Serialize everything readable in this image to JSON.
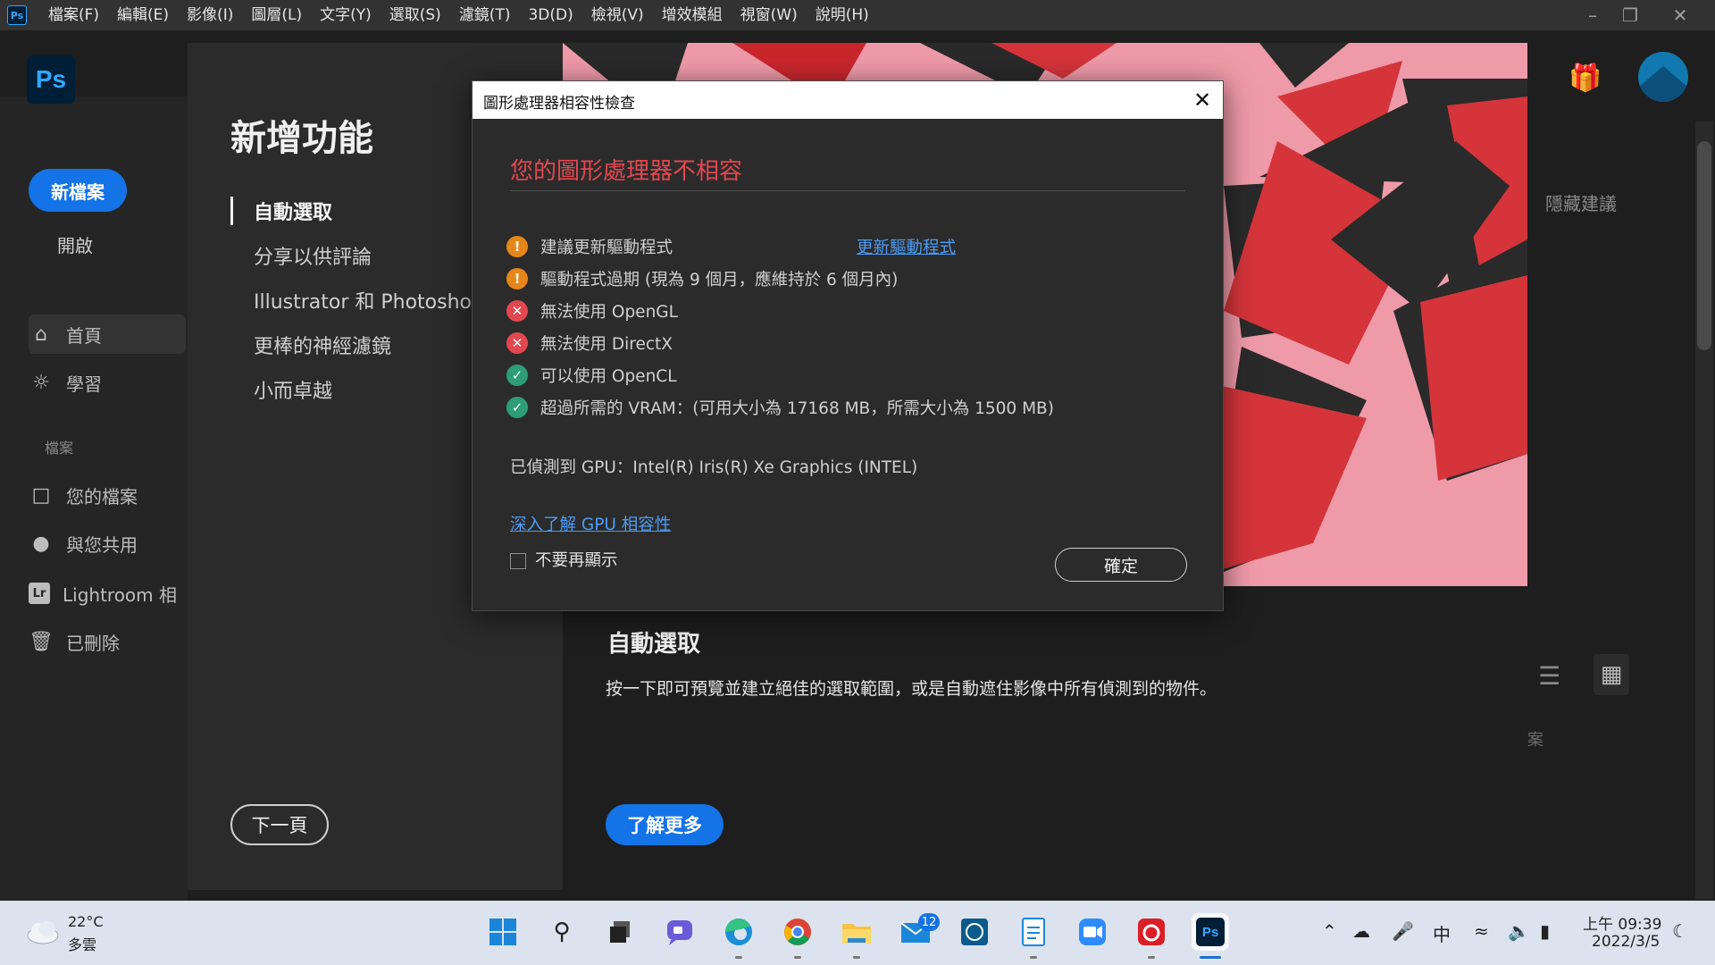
{
  "menubar": {
    "app_icon": "Ps",
    "items": [
      "檔案(F)",
      "編輯(E)",
      "影像(I)",
      "圖層(L)",
      "文字(Y)",
      "選取(S)",
      "濾鏡(T)",
      "3D(D)",
      "檢視(V)",
      "增效模組",
      "視窗(W)",
      "說明(H)"
    ]
  },
  "home": {
    "logo": "Ps",
    "new_file": "新檔案",
    "open": "開啟",
    "nav": [
      {
        "label": "首頁",
        "icon": "home-icon"
      },
      {
        "label": "學習",
        "icon": "lightbulb-icon"
      }
    ],
    "files_section": "檔案",
    "files_nav": [
      {
        "label": "您的檔案",
        "icon": "document-icon"
      },
      {
        "label": "與您共用",
        "icon": "shared-user-icon"
      },
      {
        "label": "Lightroom 相",
        "icon": "lightroom-icon"
      },
      {
        "label": "已刪除",
        "icon": "trash-icon"
      }
    ],
    "hide_suggestions": "隱藏建議",
    "partial_text": "案"
  },
  "whats_new": {
    "title": "新增功能",
    "items": [
      "自動選取",
      "分享以供評論",
      "Illustrator 和 Photoshop",
      "更棒的神經濾鏡",
      "小而卓越"
    ],
    "next_button": "下一頁",
    "feature_title": "自動選取",
    "feature_description": "按一下即可預覽並建立絕佳的選取範圍，或是自動遮住影像中所有偵測到的物件。",
    "learn_more_button": "了解更多"
  },
  "gpu_dialog": {
    "title": "圖形處理器相容性檢查",
    "heading": "您的圖形處理器不相容",
    "checks": [
      {
        "status": "warning",
        "text": "建議更新驅動程式"
      },
      {
        "status": "warning",
        "text": "驅動程式過期 (現為 9 個月，應維持於 6 個月內)"
      },
      {
        "status": "error",
        "text": "無法使用 OpenGL"
      },
      {
        "status": "error",
        "text": "無法使用 DirectX"
      },
      {
        "status": "ok",
        "text": "可以使用 OpenCL"
      },
      {
        "status": "ok",
        "text": "超過所需的 VRAM：(可用大小為 17168 MB，所需大小為 1500 MB)"
      }
    ],
    "update_driver_link": "更新驅動程式",
    "gpu_detected": "已偵測到 GPU：Intel(R) Iris(R) Xe Graphics (INTEL)",
    "learn_link": "深入了解 GPU 相容性",
    "dont_show_label": "不要再顯示",
    "ok_button": "確定"
  },
  "taskbar": {
    "weather_temp": "22°C",
    "weather_desc": "多雲",
    "mail_badge": "12",
    "input_method": "中",
    "clock_time": "上午 09:39",
    "clock_date": "2022/3/5",
    "ps_icon": "Ps"
  },
  "colors": {
    "accent": "#1473e6",
    "error": "#e34850",
    "warning": "#e68619",
    "success": "#2d9d78",
    "hero_bg": "#ef9aa9"
  }
}
